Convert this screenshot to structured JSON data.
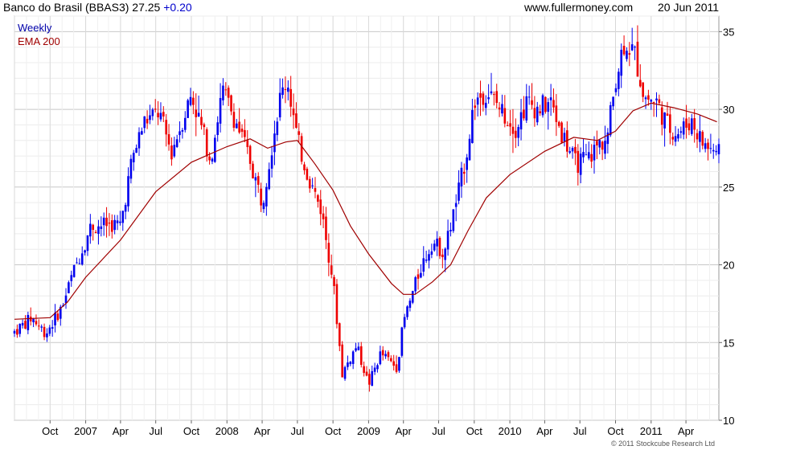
{
  "header": {
    "title": "Banco do Brasil (BBAS3)",
    "last": "27.25",
    "change": "+0.20",
    "website": "www.fullermoney.com",
    "date": "20 Jun 2011"
  },
  "footer": {
    "copyright": "© 2011 Stockcube Research Ltd"
  },
  "colors": {
    "up": "#0000ee",
    "down": "#ee0000",
    "ema": "#a00000",
    "grid": "#d8d8d8",
    "legend_weekly": "#0000aa",
    "legend_ema": "#a00000"
  },
  "chart_data": {
    "type": "candlestick",
    "timeframe": "Weekly",
    "ylim": [
      10,
      36
    ],
    "y_ticks": [
      10,
      15,
      20,
      25,
      30,
      35
    ],
    "x_ticks": [
      "Oct",
      "2007",
      "Apr",
      "Jul",
      "Oct",
      "2008",
      "Apr",
      "Jul",
      "Oct",
      "2009",
      "Apr",
      "Jul",
      "Oct",
      "2010",
      "Apr",
      "Jul",
      "Oct",
      "2011",
      "Apr"
    ],
    "x_tick_dates": [
      "2006-10-01",
      "2007-01-01",
      "2007-04-01",
      "2007-07-01",
      "2007-10-01",
      "2008-01-01",
      "2008-04-01",
      "2008-07-01",
      "2008-10-01",
      "2009-01-01",
      "2009-04-01",
      "2009-07-01",
      "2009-10-01",
      "2010-01-01",
      "2010-04-01",
      "2010-07-01",
      "2010-10-01",
      "2011-01-01",
      "2011-04-01"
    ],
    "x_range": [
      "2006-07-01",
      "2011-06-25"
    ],
    "grid": true,
    "legend": {
      "placement": "top-left",
      "entries": [
        "Weekly",
        "EMA 200"
      ]
    },
    "price_keypoints": [
      {
        "date": "2006-07-01",
        "close": 15.7
      },
      {
        "date": "2006-08-15",
        "close": 16.6
      },
      {
        "date": "2006-09-20",
        "close": 15.6
      },
      {
        "date": "2006-11-01",
        "close": 17.3
      },
      {
        "date": "2006-12-01",
        "close": 19.6
      },
      {
        "date": "2007-01-15",
        "close": 22.5
      },
      {
        "date": "2007-03-01",
        "close": 22.6
      },
      {
        "date": "2007-04-01",
        "close": 22.6
      },
      {
        "date": "2007-05-01",
        "close": 26.8
      },
      {
        "date": "2007-06-01",
        "close": 29.2
      },
      {
        "date": "2007-07-10",
        "close": 29.8
      },
      {
        "date": "2007-08-10",
        "close": 27.2
      },
      {
        "date": "2007-10-01",
        "close": 31.0
      },
      {
        "date": "2007-11-20",
        "close": 26.8
      },
      {
        "date": "2007-12-20",
        "close": 31.2
      },
      {
        "date": "2008-01-20",
        "close": 29.5
      },
      {
        "date": "2008-03-01",
        "close": 26.7
      },
      {
        "date": "2008-04-01",
        "close": 24.0
      },
      {
        "date": "2008-05-15",
        "close": 30.5
      },
      {
        "date": "2008-06-05",
        "close": 32.0
      },
      {
        "date": "2008-07-01",
        "close": 28.0
      },
      {
        "date": "2008-08-01",
        "close": 25.5
      },
      {
        "date": "2008-09-01",
        "close": 23.5
      },
      {
        "date": "2008-10-01",
        "close": 19.0
      },
      {
        "date": "2008-10-25",
        "close": 13.0
      },
      {
        "date": "2008-12-01",
        "close": 14.8
      },
      {
        "date": "2009-01-01",
        "close": 12.3
      },
      {
        "date": "2009-02-01",
        "close": 14.3
      },
      {
        "date": "2009-03-15",
        "close": 13.4
      },
      {
        "date": "2009-04-01",
        "close": 16.3
      },
      {
        "date": "2009-05-15",
        "close": 19.8
      },
      {
        "date": "2009-06-15",
        "close": 21.5
      },
      {
        "date": "2009-07-15",
        "close": 20.8
      },
      {
        "date": "2009-08-15",
        "close": 24.0
      },
      {
        "date": "2009-09-10",
        "close": 27.0
      },
      {
        "date": "2009-10-01",
        "close": 30.5
      },
      {
        "date": "2009-11-01",
        "close": 31.2
      },
      {
        "date": "2009-12-15",
        "close": 29.8
      },
      {
        "date": "2010-01-15",
        "close": 28.8
      },
      {
        "date": "2010-02-15",
        "close": 30.5
      },
      {
        "date": "2010-03-15",
        "close": 30.0
      },
      {
        "date": "2010-04-15",
        "close": 30.5
      },
      {
        "date": "2010-05-15",
        "close": 28.5
      },
      {
        "date": "2010-06-20",
        "close": 26.5
      },
      {
        "date": "2010-07-20",
        "close": 26.8
      },
      {
        "date": "2010-08-20",
        "close": 27.8
      },
      {
        "date": "2010-09-10",
        "close": 28.2
      },
      {
        "date": "2010-10-01",
        "close": 32.0
      },
      {
        "date": "2010-10-25",
        "close": 34.5
      },
      {
        "date": "2010-11-20",
        "close": 33.5
      },
      {
        "date": "2010-12-15",
        "close": 30.8
      },
      {
        "date": "2011-01-15",
        "close": 30.5
      },
      {
        "date": "2011-02-15",
        "close": 28.8
      },
      {
        "date": "2011-03-15",
        "close": 28.5
      },
      {
        "date": "2011-04-15",
        "close": 29.3
      },
      {
        "date": "2011-05-15",
        "close": 27.8
      },
      {
        "date": "2011-06-20",
        "close": 27.25
      }
    ],
    "ema_200": [
      {
        "date": "2006-07-01",
        "value": 16.5
      },
      {
        "date": "2006-10-01",
        "value": 16.6
      },
      {
        "date": "2006-11-15",
        "value": 17.6
      },
      {
        "date": "2007-01-01",
        "value": 19.2
      },
      {
        "date": "2007-04-01",
        "value": 21.6
      },
      {
        "date": "2007-07-01",
        "value": 24.7
      },
      {
        "date": "2007-10-01",
        "value": 26.6
      },
      {
        "date": "2008-01-01",
        "value": 27.6
      },
      {
        "date": "2008-03-01",
        "value": 28.1
      },
      {
        "date": "2008-04-15",
        "value": 27.5
      },
      {
        "date": "2008-06-01",
        "value": 27.9
      },
      {
        "date": "2008-07-01",
        "value": 28.0
      },
      {
        "date": "2008-08-15",
        "value": 26.5
      },
      {
        "date": "2008-10-01",
        "value": 24.8
      },
      {
        "date": "2008-11-15",
        "value": 22.5
      },
      {
        "date": "2009-01-01",
        "value": 20.7
      },
      {
        "date": "2009-03-01",
        "value": 18.8
      },
      {
        "date": "2009-04-01",
        "value": 18.1
      },
      {
        "date": "2009-05-01",
        "value": 18.1
      },
      {
        "date": "2009-06-15",
        "value": 18.9
      },
      {
        "date": "2009-08-01",
        "value": 20.0
      },
      {
        "date": "2009-09-15",
        "value": 22.2
      },
      {
        "date": "2009-11-01",
        "value": 24.3
      },
      {
        "date": "2010-01-01",
        "value": 25.8
      },
      {
        "date": "2010-04-01",
        "value": 27.3
      },
      {
        "date": "2010-06-15",
        "value": 28.2
      },
      {
        "date": "2010-08-15",
        "value": 28.0
      },
      {
        "date": "2010-10-01",
        "value": 28.6
      },
      {
        "date": "2010-11-15",
        "value": 29.9
      },
      {
        "date": "2011-01-01",
        "value": 30.4
      },
      {
        "date": "2011-03-01",
        "value": 30.1
      },
      {
        "date": "2011-05-01",
        "value": 29.7
      },
      {
        "date": "2011-06-20",
        "value": 29.2
      }
    ]
  }
}
